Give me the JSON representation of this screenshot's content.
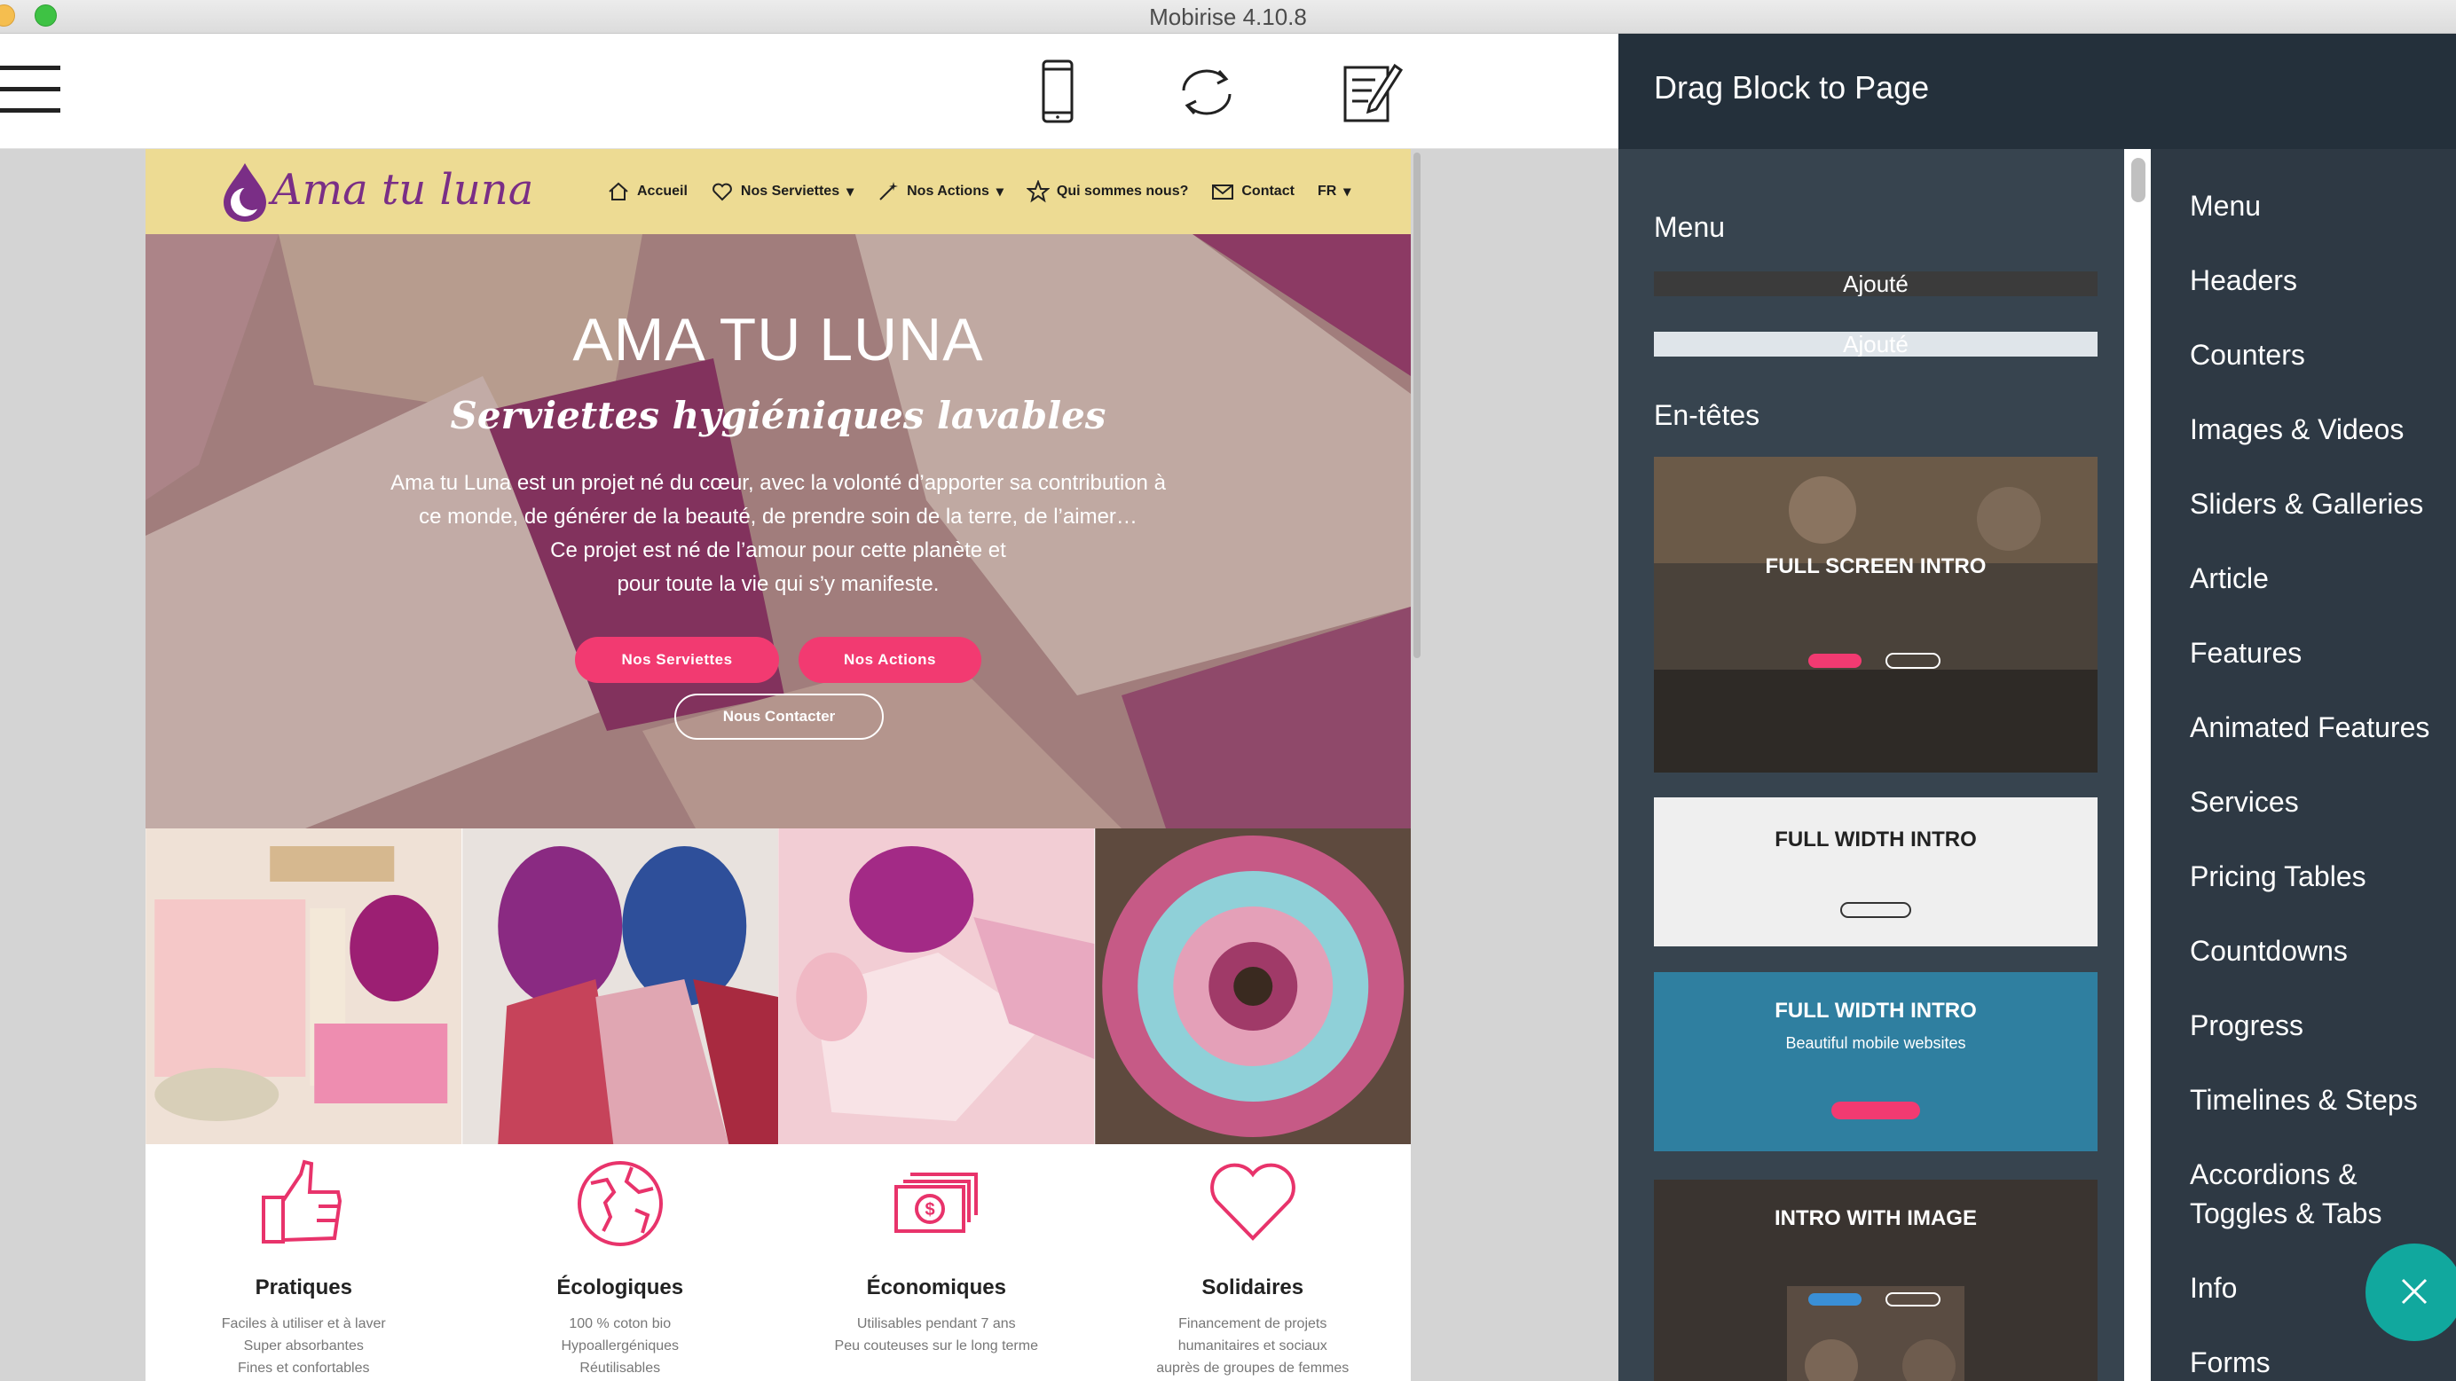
{
  "window": {
    "title": "Mobirise 4.10.8"
  },
  "toolbar": {
    "menu_icon": "hamburger-icon",
    "icons": [
      "mobile-preview-icon",
      "sync-icon",
      "edit-page-icon"
    ]
  },
  "site": {
    "logo_text": "Ama tu luna",
    "nav": [
      "Accueil",
      "Nos Serviettes",
      "Nos Actions",
      "Qui sommes nous?",
      "Contact",
      "FR"
    ],
    "hero": {
      "title": "AMA TU LUNA",
      "subtitle": "Serviettes hygiéniques lavables",
      "paragraph": [
        "Ama tu Luna est un projet né du cœur, avec la volonté d’apporter sa contribution à",
        "ce monde, de générer de la beauté, de prendre soin de la terre, de l’aimer…",
        "Ce projet est né de l’amour pour cette planète et",
        "pour toute la vie qui s’y manifeste."
      ],
      "btn1": "Nos Serviettes",
      "btn2": "Nos Actions",
      "btn3": "Nous Contacter"
    },
    "features": [
      {
        "title": "Pratiques",
        "lines": [
          "Faciles à utiliser et à laver",
          "Super absorbantes",
          "Fines et confortables"
        ]
      },
      {
        "title": "Écologiques",
        "lines": [
          "100 % coton bio",
          "Hypoallergéniques",
          "Réutilisables"
        ]
      },
      {
        "title": "Économiques",
        "lines": [
          "Utilisables pendant 7 ans",
          "Peu couteuses sur le long terme"
        ]
      },
      {
        "title": "Solidaires",
        "lines": [
          "Financement de projets",
          "humanitaires et sociaux",
          "auprès de groupes de femmes"
        ]
      }
    ]
  },
  "panel": {
    "heading": "Drag Block to Page",
    "menu_label": "Menu",
    "added_label": "Ajouté",
    "headers_label": "En-têtes",
    "thumbs": [
      {
        "title": "FULL SCREEN INTRO"
      },
      {
        "title": "FULL WIDTH INTRO"
      },
      {
        "title": "FULL WIDTH INTRO",
        "subtitle": "Beautiful mobile websites"
      },
      {
        "title": "INTRO WITH IMAGE"
      }
    ],
    "categories": [
      "Menu",
      "Headers",
      "Counters",
      "Images & Videos",
      "Sliders & Galleries",
      "Article",
      "Features",
      "Animated Features",
      "Services",
      "Pricing Tables",
      "Countdowns",
      "Progress",
      "Timelines & Steps",
      "Accordions &",
      "Toggles & Tabs",
      "Info",
      "Forms"
    ]
  },
  "colors": {
    "accent_pink": "#f23a71",
    "nav_yellow": "#eddb93",
    "panel_dark": "#2e3944",
    "fab_teal": "#11a89e"
  }
}
